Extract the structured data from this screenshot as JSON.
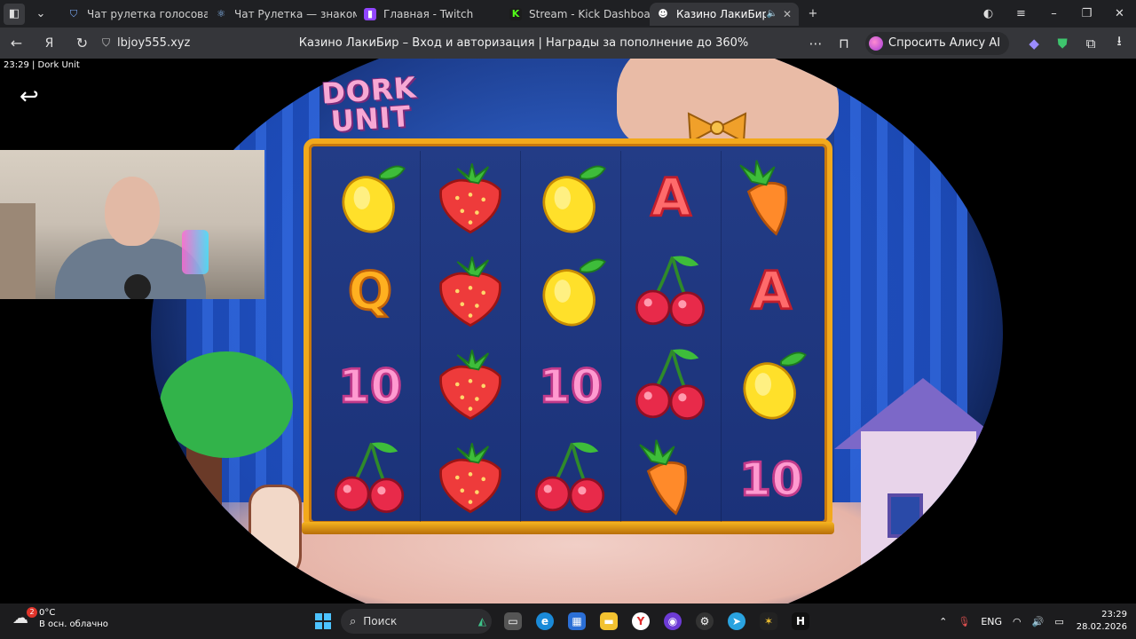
{
  "tabs": [
    {
      "label": "Чат рулетка голосовая –",
      "icon": "shield-icon",
      "active": false
    },
    {
      "label": "Чат Рулетка — знакомств",
      "icon": "react-icon",
      "active": false
    },
    {
      "label": "Главная - Twitch",
      "icon": "twitch-icon",
      "active": false
    },
    {
      "label": "Stream - Kick Dashboard",
      "icon": "kick-icon",
      "active": false
    },
    {
      "label": "Казино ЛакиБир – В",
      "icon": "site-icon",
      "active": true
    }
  ],
  "address": {
    "url": "lbjoy555.xyz",
    "page_title": "Казино ЛакиБир – Вход и авторизация | Награды за пополнение до 360%",
    "alice_label": "Спросить Алису AI"
  },
  "stream_info": "23:29  |  Dork Unit",
  "game": {
    "logo": [
      "DORK",
      "UNIT"
    ],
    "grid": [
      [
        "lemon",
        "strawberry",
        "lemon",
        "A",
        "carrot"
      ],
      [
        "Q",
        "strawberry",
        "lemon",
        "cherry",
        "A"
      ],
      [
        "10",
        "strawberry",
        "10",
        "cherry",
        "lemon"
      ],
      [
        "cherry",
        "strawberry",
        "cherry",
        "carrot",
        "10"
      ]
    ]
  },
  "taskbar": {
    "weather_temp": "0°C",
    "weather_desc": "В осн. облачно",
    "weather_badge": "2",
    "search_label": "Поиск",
    "lang": "ENG",
    "time": "23:29",
    "date": "28.02.2026"
  },
  "colors": {
    "accent_gold": "#f2a91c",
    "stage_blue": "#2854b4"
  }
}
